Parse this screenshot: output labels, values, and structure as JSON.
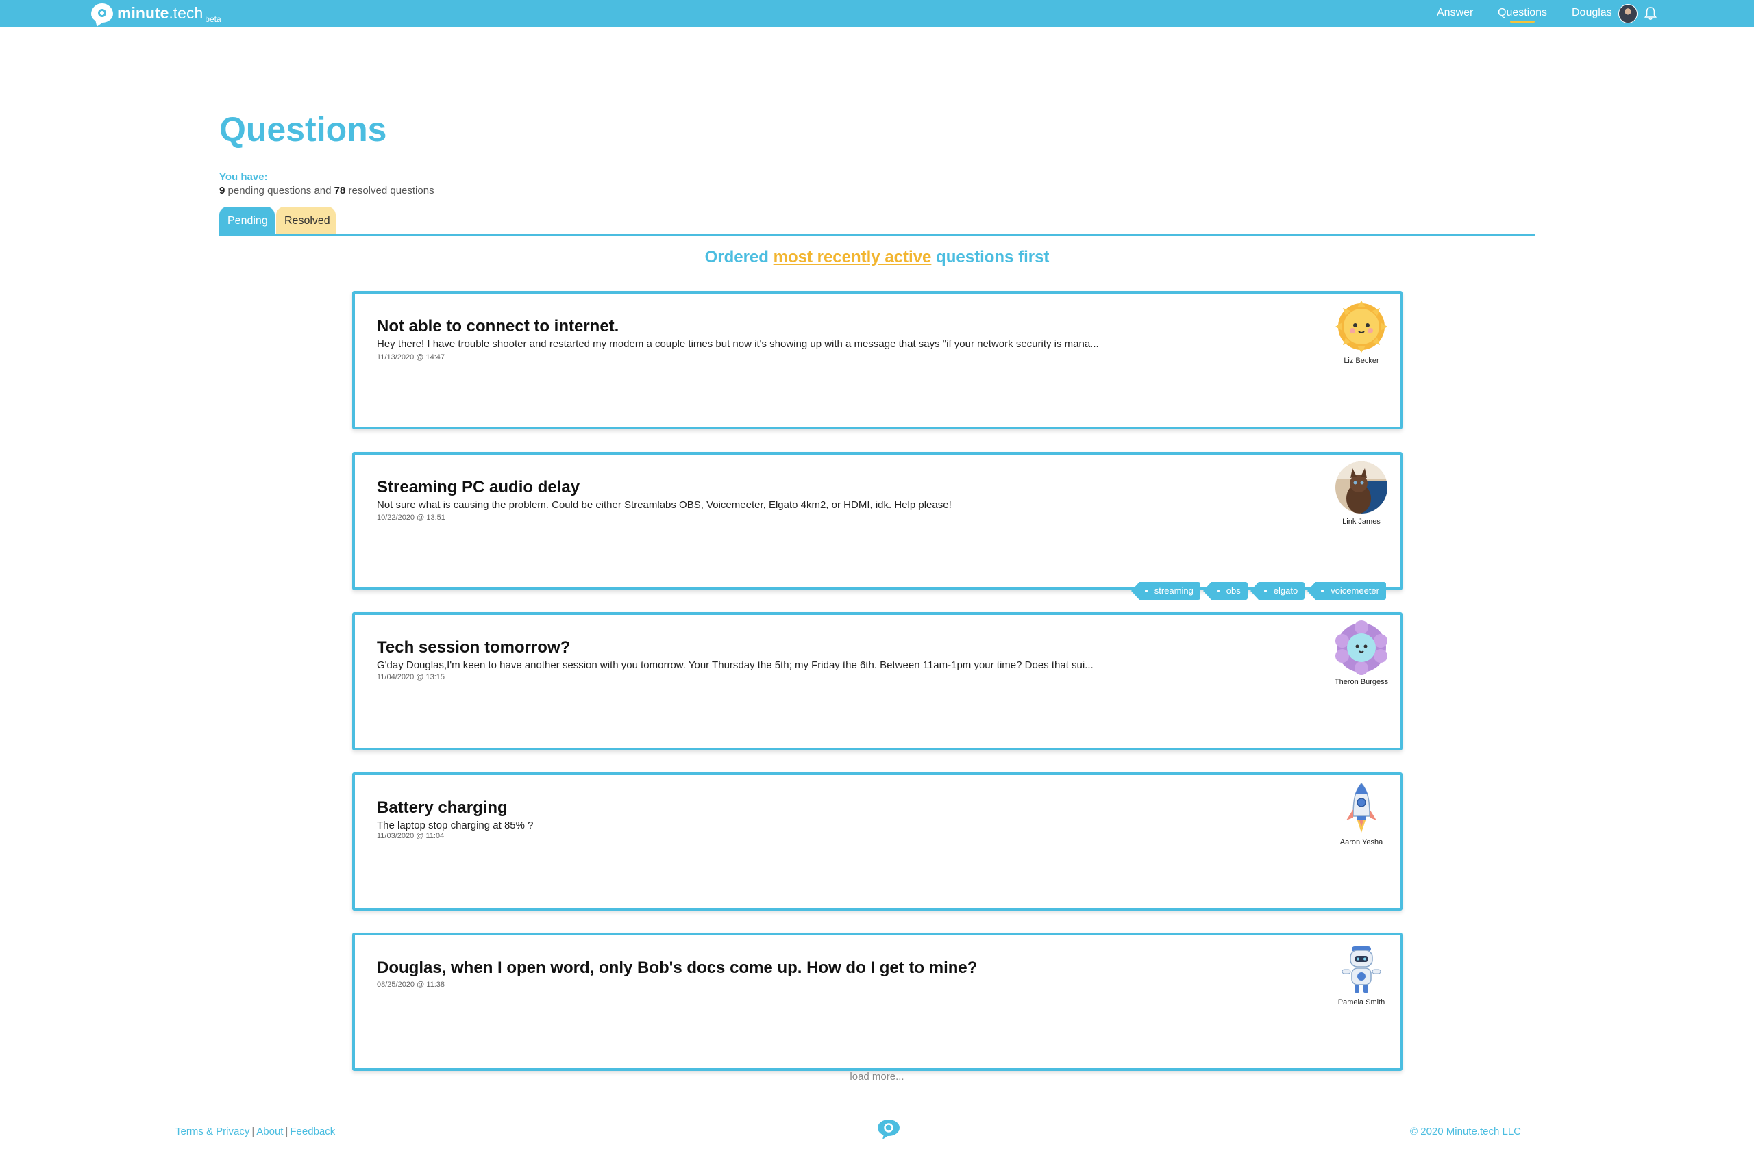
{
  "brand": {
    "name_bold": "minute",
    "name_rest": ".tech",
    "badge": "beta"
  },
  "nav": {
    "answer": "Answer",
    "questions": "Questions",
    "user": "Douglas"
  },
  "header": {
    "title": "Questions",
    "you_have": "You have:",
    "pending_count": "9",
    "pending_text": " pending questions and ",
    "resolved_count": "78",
    "resolved_text": " resolved questions"
  },
  "tabs": {
    "pending": "Pending",
    "resolved": "Resolved"
  },
  "order_note": {
    "before": "Ordered ",
    "highlight": "most recently active",
    "after": " questions first"
  },
  "questions": [
    {
      "title": "Not able to connect to internet.",
      "body": "Hey there! I have trouble shooter and restarted my modem a couple times but now it's showing up with a message that says \"if your network security is mana...",
      "date": "11/13/2020 @ 14:47",
      "user": "Liz Becker",
      "avatar": "sun-avatar",
      "tags": []
    },
    {
      "title": "Streaming PC audio delay",
      "body": "Not sure what is causing the problem. Could be either Streamlabs OBS, Voicemeeter, Elgato 4km2, or HDMI, idk. Help please!",
      "date": "10/22/2020 @ 13:51",
      "user": "Link James",
      "avatar": "cat-photo-avatar",
      "tags": [
        "streaming",
        "obs",
        "elgato",
        "voicemeeter"
      ]
    },
    {
      "title": "Tech session tomorrow?",
      "body": "G'day Douglas,I'm keen to have another session with you tomorrow.  Your Thursday the 5th; my Friday the 6th.  Between 11am-1pm your time?  Does that sui...",
      "date": "11/04/2020 @ 13:15",
      "user": "Theron Burgess",
      "avatar": "flower-avatar",
      "tags": []
    },
    {
      "title": "Battery charging",
      "body": "The laptop stop  charging at 85% ?",
      "date": "11/03/2020 @ 11:04",
      "user": "Aaron Yesha",
      "avatar": "rocket-avatar",
      "tags": []
    },
    {
      "title": "Douglas, when I open word, only Bob's docs come up. How do I get to mine?",
      "body": "",
      "date": "08/25/2020 @ 11:38",
      "user": "Pamela Smith",
      "avatar": "robot-avatar",
      "tags": []
    }
  ],
  "load_more": "load more...",
  "footer": {
    "terms": "Terms & Privacy",
    "about": "About",
    "feedback": "Feedback",
    "separator": "|",
    "copyright": "© 2020 Minute.tech LLC"
  },
  "colors": {
    "primary": "#4bbde0",
    "accent": "#f2b530",
    "resolved_tab": "#fbe3a0"
  }
}
